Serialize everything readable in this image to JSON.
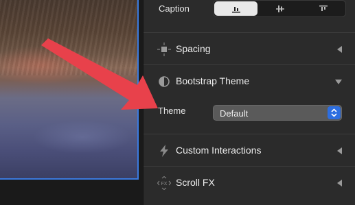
{
  "caption": {
    "label": "Caption",
    "options": [
      "align-bottom",
      "align-middle",
      "align-top"
    ],
    "selected_index": 0
  },
  "sections": {
    "spacing": {
      "label": "Spacing",
      "icon": "spacing-icon"
    },
    "bootstrap": {
      "label": "Bootstrap Theme",
      "icon": "theme-contrast-icon",
      "expanded": true
    },
    "custom": {
      "label": "Custom Interactions",
      "icon": "lightning-icon"
    },
    "scroll": {
      "label": "Scroll FX",
      "icon": "scroll-fx-icon"
    }
  },
  "theme": {
    "label": "Theme",
    "value": "Default"
  },
  "colors": {
    "accent": "#2d6ee0",
    "annotation_arrow": "#e8414b",
    "selection_border": "#3b7be0"
  }
}
